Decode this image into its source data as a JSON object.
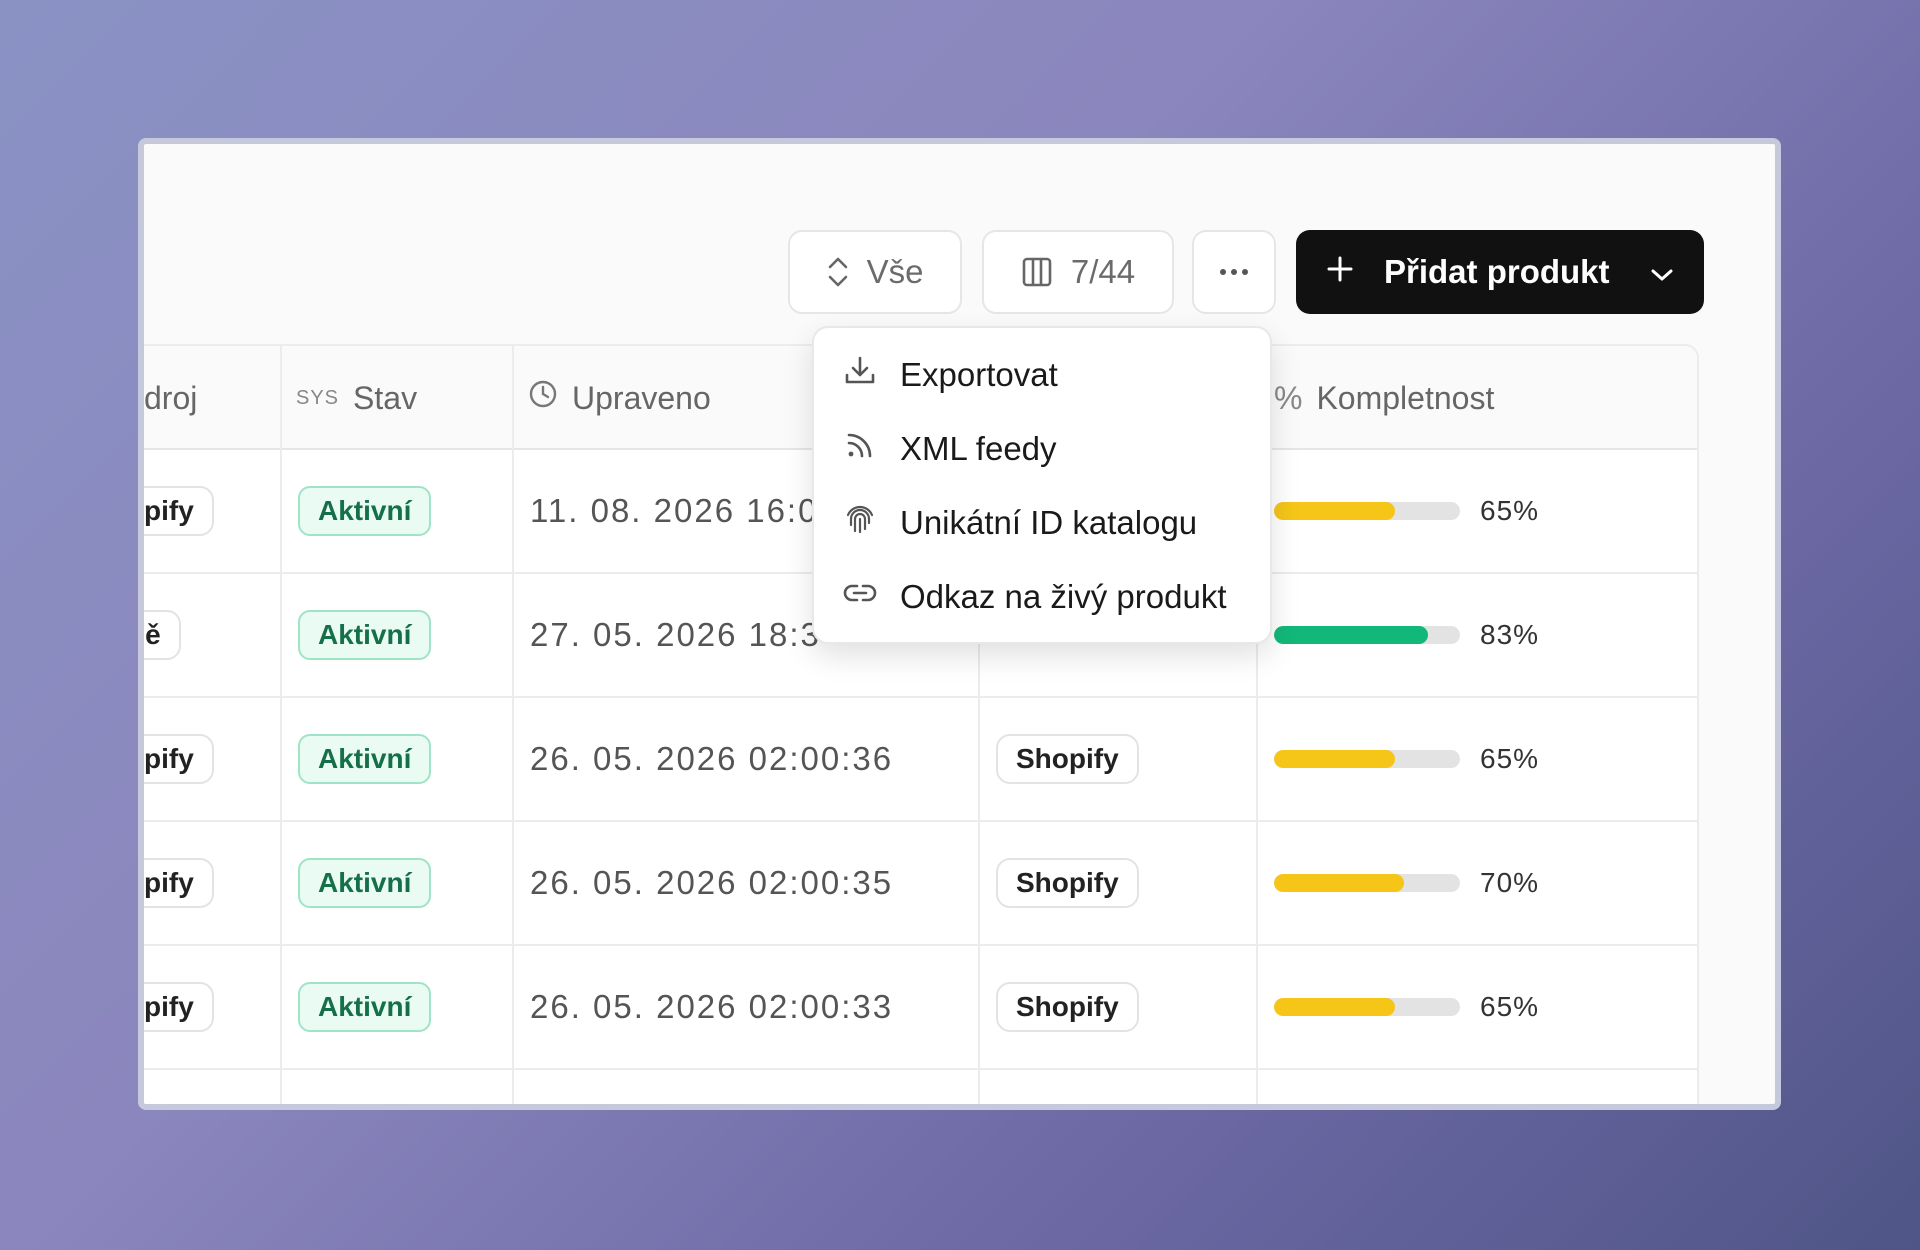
{
  "toolbar": {
    "sort_label": "Vše",
    "columns_label": "7/44",
    "more_label": "···",
    "add_label": "Přidat produkt"
  },
  "table": {
    "headers": {
      "source": "droj",
      "status_tag": "SYS",
      "status": "Stav",
      "modified": "Upraveno",
      "completeness_icon": "%",
      "completeness": "Kompletnost"
    },
    "rows": [
      {
        "source": "pify",
        "status": "Aktivní",
        "modified": "11. 08. 2026 16:0",
        "channel": "",
        "pct": "65%",
        "fill": 0.65,
        "color": "#f5c518"
      },
      {
        "source": "ně",
        "status": "Aktivní",
        "modified": "27. 05. 2026 18:3",
        "channel": "",
        "pct": "83%",
        "fill": 0.83,
        "color": "#12b87a"
      },
      {
        "source": "pify",
        "status": "Aktivní",
        "modified": "26. 05. 2026 02:00:36",
        "channel": "Shopify",
        "pct": "65%",
        "fill": 0.65,
        "color": "#f5c518"
      },
      {
        "source": "pify",
        "status": "Aktivní",
        "modified": "26. 05. 2026 02:00:35",
        "channel": "Shopify",
        "pct": "70%",
        "fill": 0.7,
        "color": "#f5c518"
      },
      {
        "source": "pify",
        "status": "Aktivní",
        "modified": "26. 05. 2026 02:00:33",
        "channel": "Shopify",
        "pct": "65%",
        "fill": 0.65,
        "color": "#f5c518"
      }
    ]
  },
  "menu": {
    "items": [
      {
        "label": "Exportovat",
        "icon": "download-icon"
      },
      {
        "label": "XML feedy",
        "icon": "rss-icon"
      },
      {
        "label": "Unikátní ID katalogu",
        "icon": "fingerprint-icon"
      },
      {
        "label": "Odkaz na živý produkt",
        "icon": "link-icon"
      }
    ]
  }
}
